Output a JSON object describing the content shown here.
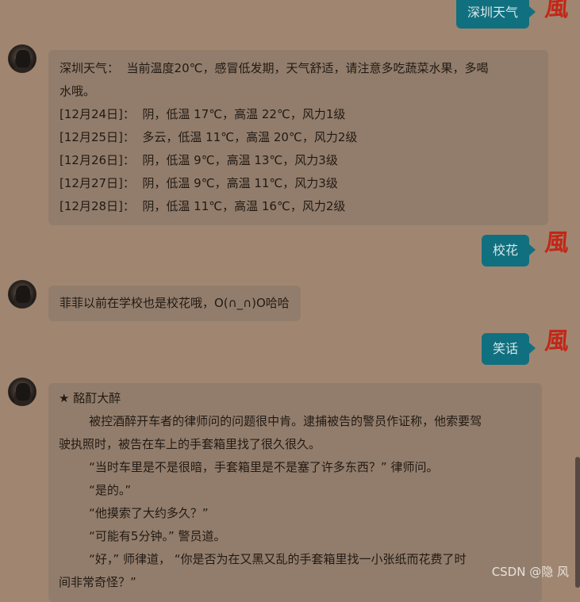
{
  "chat": {
    "user_avatar_char": "風",
    "msg1_user": "深圳天气",
    "msg2_bot": [
      "深圳天气：  当前温度20℃，感冒低发期，天气舒适，请注意多吃蔬菜水果，多喝",
      "水哦。",
      "[12月24日]：  阴，低温 17℃，高温 22℃，风力1级",
      "[12月25日]：  多云，低温 11℃，高温 20℃，风力2级",
      "[12月26日]：  阴，低温 9℃，高温 13℃，风力3级",
      "[12月27日]：  阴，低温 9℃，高温 11℃，风力3级",
      "[12月28日]：  阴，低温 11℃，高温 16℃，风力2级"
    ],
    "msg3_user": "校花",
    "msg4_bot": "菲菲以前在学校也是校花哦，O(∩_∩)O哈哈",
    "msg5_user": "笑话",
    "msg6_bot": [
      "★ 酩酊大醉",
      "        被控酒醉开车者的律师问的问题很中肯。逮捕被告的警员作证称，他索要驾",
      "驶执照时，被告在车上的手套箱里找了很久很久。",
      "        “当时车里是不是很暗，手套箱里是不是塞了许多东西？” 律师问。",
      "        “是的。”",
      "        “他摸索了大约多久？”",
      "        “可能有5分钟。” 警员道。",
      "        “好，” 师律道， “你是否为在又黑又乱的手套箱里找一小张纸而花费了时",
      "间非常奇怪？”"
    ]
  },
  "watermark": "CSDN @隐 风"
}
